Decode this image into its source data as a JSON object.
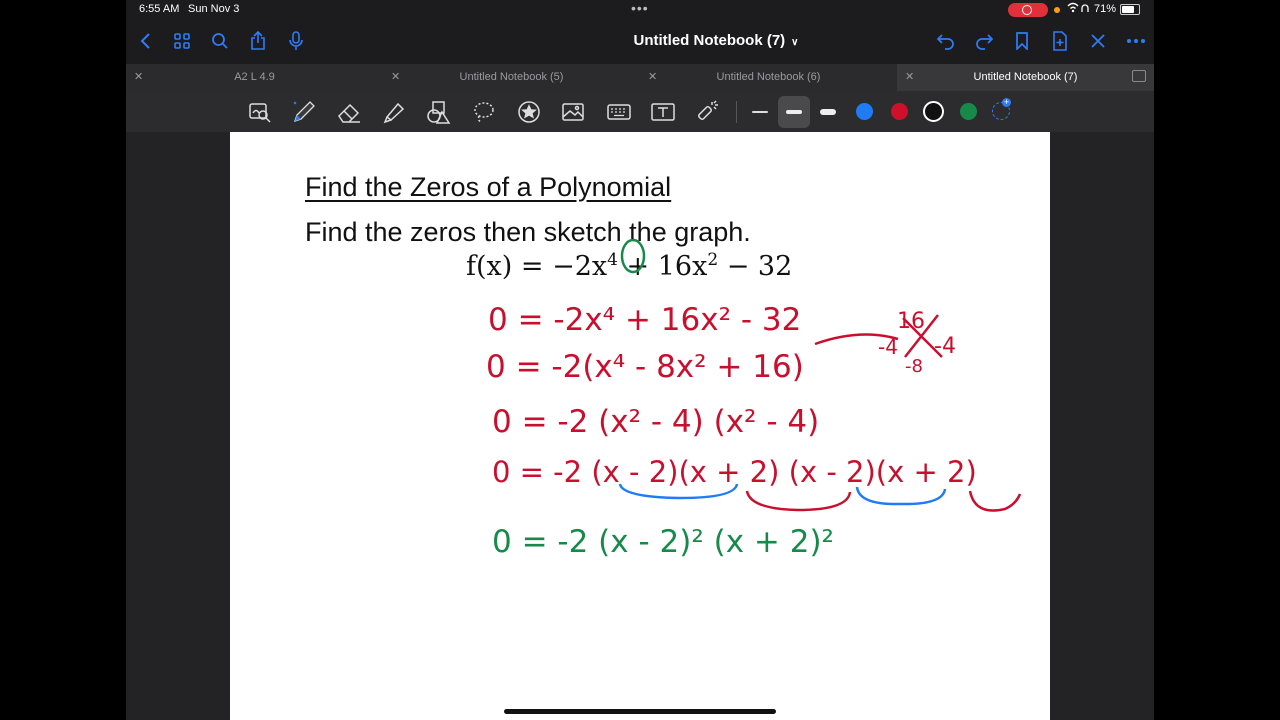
{
  "status_bar": {
    "time": "6:55 AM",
    "date": "Sun Nov 3",
    "battery": "71%"
  },
  "nav": {
    "title": "Untitled Notebook (7)",
    "left_icons": [
      "back-icon",
      "grid-icon",
      "search-icon",
      "share-icon",
      "microphone-icon"
    ],
    "right_icons": [
      "undo-icon",
      "redo-icon",
      "bookmark-icon",
      "add-page-icon",
      "close-icon",
      "more-icon"
    ]
  },
  "tabs": [
    {
      "label": "A2 L 4.9",
      "active": false
    },
    {
      "label": "Untitled Notebook (5)",
      "active": false
    },
    {
      "label": "Untitled Notebook (6)",
      "active": false
    },
    {
      "label": "Untitled Notebook (7)",
      "active": true
    }
  ],
  "toolbar": {
    "tools": [
      "zoom-window-icon",
      "pen-icon",
      "eraser-icon",
      "highlighter-icon",
      "shapes-icon",
      "lasso-icon",
      "sticker-icon",
      "image-icon",
      "keyboard-icon",
      "text-box-icon",
      "laser-pointer-icon"
    ],
    "stroke_sizes": [
      "thin",
      "medium",
      "thick"
    ],
    "colors": [
      "#1f7cf5",
      "#d0102a",
      "#111111",
      "#178a4a"
    ]
  },
  "document": {
    "heading": "Find the Zeros of a Polynomial",
    "instruction": "Find the zeros then sketch the graph.",
    "function_parts": {
      "lhs": "f(x) = −2x",
      "exp1": "4",
      "mid": " + 16x",
      "exp2": "2",
      "rhs": " − 32"
    }
  },
  "handwriting": {
    "line1": "0 = -2x⁴ + 16x² - 32",
    "line2": "0 = -2(x⁴ - 8x² + 16)",
    "line3": "0 = -2 (x² - 4) (x² - 4)",
    "line4": "0 = -2 (x - 2)(x + 2) (x - 2)(x + 2)",
    "line5": "0 = -2 (x - 2)² (x + 2)²",
    "side_16": "16",
    "side_neg4a": "-4",
    "side_neg4b": "-4",
    "side_neg8": "-8"
  }
}
